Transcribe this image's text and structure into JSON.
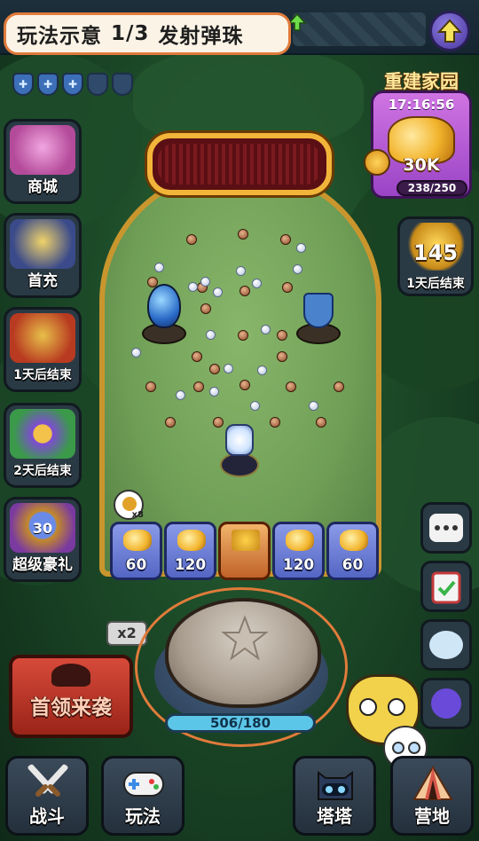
{
  "tutorial": {
    "title": "玩法示意",
    "step": "1/3",
    "subtitle": "发射弹珠"
  },
  "top_right": {
    "upgrade_icon": "arrow-up-icon"
  },
  "shields": {
    "active": 3,
    "total": 5,
    "icon": "shield-icon"
  },
  "left_menu": [
    {
      "label": "商城",
      "icon": "shop-basket-icon",
      "color": "#f1a6e0"
    },
    {
      "label": "首充",
      "icon": "dog-mascot-icon",
      "color": "#f0d36a"
    },
    {
      "label": "1天后结束",
      "icon": "fox-character-icon",
      "color": "#e8c04a"
    },
    {
      "label": "2天后结束",
      "icon": "wheel-icon",
      "color": "#7f4bd4"
    },
    {
      "label": "超级豪礼",
      "icon": "gift-30-icon",
      "color": "#c48a2a",
      "badge": "30"
    }
  ],
  "rebuild": {
    "title": "重建家园",
    "timer": "17:16:56",
    "reward": "30K",
    "progress": "238/250",
    "progress_fraction": 0.952
  },
  "trophy": {
    "value": "145",
    "label": "1天后结束"
  },
  "chests": [
    {
      "value": "60",
      "special": false
    },
    {
      "value": "120",
      "special": false
    },
    {
      "value": "",
      "special": true,
      "icon": "mystery-star-icon"
    },
    {
      "value": "120",
      "special": false
    },
    {
      "value": "60",
      "special": false
    }
  ],
  "key_bubble": {
    "multiplier": "x8",
    "icon": "key-icon"
  },
  "launcher": {
    "multiplier": "x2",
    "power": "506/180",
    "icon": "star-icon"
  },
  "boss": {
    "label": "首领来袭"
  },
  "right_tools": [
    {
      "icon": "chat-icon"
    },
    {
      "icon": "clipboard-check-icon"
    },
    {
      "icon": "friends-icon"
    },
    {
      "icon": "cat-badge-icon"
    }
  ],
  "bottom_nav": [
    {
      "label": "战斗",
      "icon": "crossed-swords-icon"
    },
    {
      "label": "玩法",
      "icon": "gamepad-icon"
    },
    {
      "label": "塔塔",
      "icon": "cat-robot-icon"
    },
    {
      "label": "营地",
      "icon": "tent-icon"
    }
  ],
  "colors": {
    "banner_border": "#e07b3b",
    "board_rim": "#c9962e",
    "marquee": "#5a0f14",
    "power_bar": "#5cc6e8"
  }
}
